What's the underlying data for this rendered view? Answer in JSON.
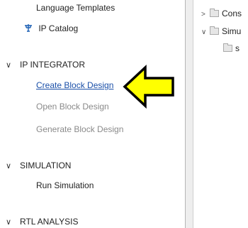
{
  "flow_navigator": {
    "language_templates": "Language Templates",
    "ip_catalog": "IP Catalog",
    "ip_integrator": {
      "title": "IP INTEGRATOR",
      "create_block_design": "Create Block Design",
      "open_block_design": "Open Block Design",
      "generate_block_design": "Generate Block Design"
    },
    "simulation": {
      "title": "SIMULATION",
      "run_simulation": "Run Simulation"
    },
    "rtl_analysis": {
      "title": "RTL ANALYSIS"
    }
  },
  "sources_tree": {
    "items": [
      {
        "label": "Cons",
        "expanded": false
      },
      {
        "label": "Simu",
        "expanded": true
      },
      {
        "label": "s"
      }
    ]
  },
  "annotation": {
    "arrow_color": "#ffff00",
    "arrow_outline": "#000000"
  }
}
